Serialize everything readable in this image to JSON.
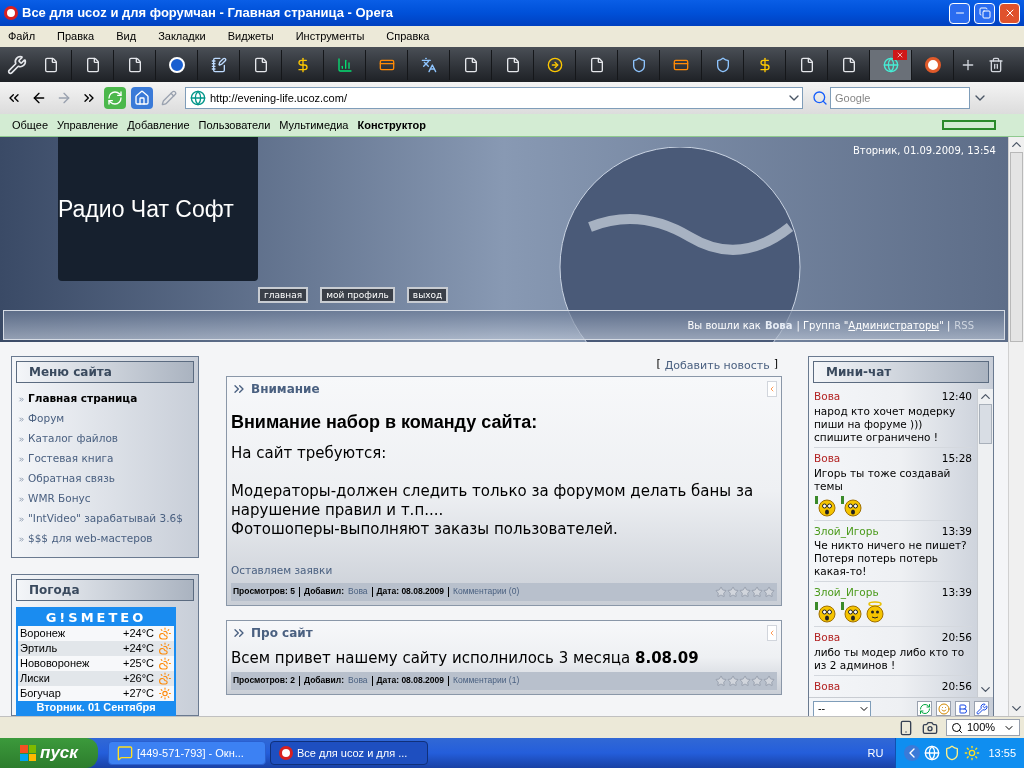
{
  "window": {
    "title": "Все для ucoz и для форумчан - Главная страница - Opera"
  },
  "menu": [
    "Файл",
    "Правка",
    "Вид",
    "Закладки",
    "Виджеты",
    "Инструменты",
    "Справка"
  ],
  "tabs": [
    {
      "kind": "page",
      "selected": false
    },
    {
      "kind": "page",
      "selected": false
    },
    {
      "kind": "page",
      "selected": false
    },
    {
      "kind": "blue-circle",
      "selected": false
    },
    {
      "kind": "note",
      "selected": false
    },
    {
      "kind": "page",
      "selected": false
    },
    {
      "kind": "dollar",
      "selected": false
    },
    {
      "kind": "chart",
      "selected": false
    },
    {
      "kind": "card",
      "selected": false
    },
    {
      "kind": "translate",
      "selected": false
    },
    {
      "kind": "page",
      "selected": false
    },
    {
      "kind": "page",
      "selected": false
    },
    {
      "kind": "yellow-circle",
      "selected": false
    },
    {
      "kind": "page",
      "selected": false
    },
    {
      "kind": "shield",
      "selected": false
    },
    {
      "kind": "card",
      "selected": false
    },
    {
      "kind": "shield",
      "selected": false
    },
    {
      "kind": "dollar",
      "selected": false
    },
    {
      "kind": "page",
      "selected": false
    },
    {
      "kind": "page",
      "selected": false
    },
    {
      "kind": "site",
      "selected": true
    },
    {
      "kind": "opera",
      "selected": false
    }
  ],
  "address": {
    "url": "http://evening-life.ucoz.com/",
    "search_placeholder": "Google"
  },
  "admin_bar": {
    "items": [
      {
        "label": "Общее",
        "selected": false
      },
      {
        "label": "Управление",
        "selected": false
      },
      {
        "label": "Добавление",
        "selected": false
      },
      {
        "label": "Пользователи",
        "selected": false
      },
      {
        "label": "Мультимедиа",
        "selected": false
      },
      {
        "label": "Конструктор",
        "selected": true
      }
    ]
  },
  "header": {
    "datetime": "Вторник, 01.09.2009, 13:54",
    "site_title": "Радио Чат Софт",
    "buttons": [
      "главная",
      "мой профиль",
      "выход"
    ],
    "login": {
      "prefix": "Вы вошли как",
      "user": "Вова",
      "group_prefix": "| Группа \"",
      "group": "Администраторы",
      "group_suffix": "\" |",
      "rss": "RSS"
    }
  },
  "site_menu": {
    "title": "Меню сайта",
    "items": [
      {
        "label": "Главная страница",
        "selected": true
      },
      {
        "label": "Форум",
        "selected": false
      },
      {
        "label": "Каталог файлов",
        "selected": false
      },
      {
        "label": "Гостевая книга",
        "selected": false
      },
      {
        "label": "Обратная связь",
        "selected": false
      },
      {
        "label": "WMR Бонус",
        "selected": false
      },
      {
        "label": "\"IntVideo\" зарабатывай 3.6$",
        "selected": false
      },
      {
        "label": "$$$ для web-мастеров",
        "selected": false
      }
    ]
  },
  "weather": {
    "title": "Погода",
    "brand": "G!SMETEO",
    "rows": [
      {
        "city": "Воронеж",
        "temp": "+24°C",
        "kind": "sun-cloud"
      },
      {
        "city": "Эртиль",
        "temp": "+24°C",
        "kind": "sun-cloud"
      },
      {
        "city": "Нововоронеж",
        "temp": "+25°C",
        "kind": "sun-cloud"
      },
      {
        "city": "Лиски",
        "temp": "+26°C",
        "kind": "sun-cloud"
      },
      {
        "city": "Богучар",
        "temp": "+27°C",
        "kind": "sun"
      }
    ],
    "date": "Вторник. 01 Сентября"
  },
  "add_news": {
    "open": "[",
    "label": "Добавить новость",
    "close": "]"
  },
  "news": [
    {
      "title": "Внимание",
      "heading": "Внимание набор в команду сайта:",
      "paragraphs": [
        "На сайт требуются:",
        "Модераторы-должен следить только за форумом делать баны за нарушение правил и т.п....",
        "Фотошоперы-выполняют заказы пользователей."
      ],
      "more": "Оставляем заявки",
      "views": "Просмотров: 5",
      "added_label": "Добавил:",
      "author": "Вова",
      "date": "Дата: 08.08.2009",
      "comments": "Комментарии (0)",
      "stars": 0
    },
    {
      "title": "Про сайт",
      "paragraphs": [
        "Всем привет нашему сайту  исполнилось 3 месяца  **8.08.09**"
      ],
      "views": "Просмотров: 2",
      "added_label": "Добавил:",
      "author": "Вова",
      "date": "Дата: 08.08.2009",
      "comments": "Комментарии (1)",
      "stars": 0
    }
  ],
  "chat": {
    "title": "Мини-чат",
    "messages": [
      {
        "author": "Вова",
        "color": "#b22222",
        "time": "12:40",
        "text": "народ кто хочет модерку пиши на форуме ))) спишите ограничено !"
      },
      {
        "author": "Вова",
        "color": "#b22222",
        "time": "15:28",
        "text": "Игорь ты тоже создавай темы",
        "smileys": [
          {
            "kind": "drinking"
          },
          {
            "kind": "drinking"
          }
        ]
      },
      {
        "author": "Злой_Игорь",
        "color": "#4a9a1a",
        "time": "13:39",
        "text": "Че никто ничего не пишет? Потеря потерь потерь какая-то!"
      },
      {
        "author": "Злой_Игорь",
        "color": "#4a9a1a",
        "time": "13:39",
        "smileys": [
          {
            "kind": "drinking"
          },
          {
            "kind": "drinking"
          },
          {
            "kind": "angel"
          }
        ]
      },
      {
        "author": "Вова",
        "color": "#b22222",
        "time": "20:56",
        "text": "либо ты модер либо кто то из 2 админов !"
      },
      {
        "author": "Вова",
        "color": "#b22222",
        "time": "20:56"
      }
    ],
    "select_value": "--"
  },
  "status_bar": {
    "zoom": "100%"
  },
  "taskbar": {
    "start": "пуск",
    "tasks": [
      {
        "label": "[449-571-793] - Окн...",
        "kind": "chat",
        "selected": false
      },
      {
        "label": "Все для ucoz и для ...",
        "kind": "opera",
        "selected": true
      }
    ],
    "lang": "RU",
    "clock": "13:55"
  }
}
